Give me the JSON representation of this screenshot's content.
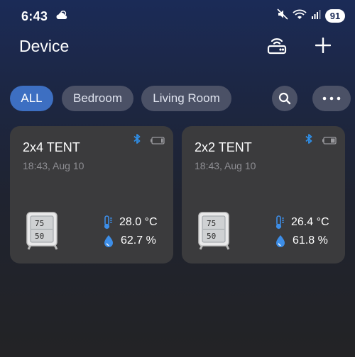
{
  "status_bar": {
    "time": "6:43",
    "battery_level": "91"
  },
  "header": {
    "title": "Device"
  },
  "filters": [
    {
      "label": "ALL",
      "active": true
    },
    {
      "label": "Bedroom",
      "active": false
    },
    {
      "label": "Living Room",
      "active": false
    }
  ],
  "devices": [
    {
      "name": "2x4 TENT",
      "updated": "18:43, Aug 10",
      "temperature": "28.0 °C",
      "humidity": "62.7 %",
      "device_temp_display": "75",
      "device_hum_display": "50"
    },
    {
      "name": "2x2 TENT",
      "updated": "18:43, Aug 10",
      "temperature": "26.4 °C",
      "humidity": "61.8 %",
      "device_temp_display": "75",
      "device_hum_display": "50"
    }
  ],
  "colors": {
    "accent": "#3d6fc2",
    "bluetooth": "#2f8fe8",
    "reading_icon": "#3d8ee8"
  }
}
